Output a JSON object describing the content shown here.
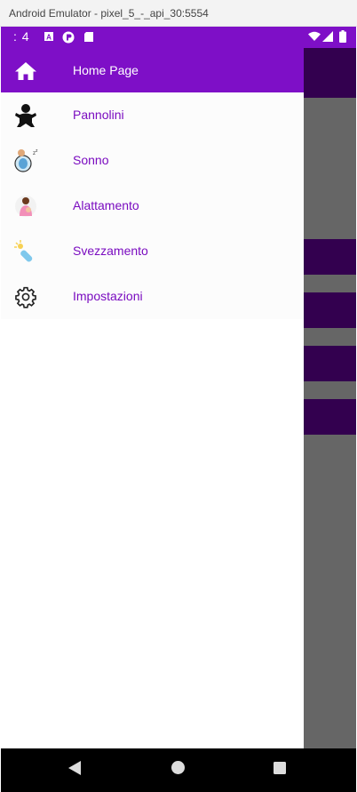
{
  "window": {
    "title": "Android Emulator - pixel_5_-_api_30:5554"
  },
  "status_bar": {
    "time": ": 4"
  },
  "drawer": {
    "items": [
      {
        "label": "Home Page",
        "icon": "home-icon",
        "active": true
      },
      {
        "label": "Pannolini",
        "icon": "baby-icon"
      },
      {
        "label": "Sonno",
        "icon": "sleeping-baby-icon"
      },
      {
        "label": "Alattamento",
        "icon": "breastfeeding-icon"
      },
      {
        "label": "Svezzamento",
        "icon": "baby-bottle-icon"
      },
      {
        "label": "Impostazioni",
        "icon": "gear-icon"
      }
    ]
  },
  "colors": {
    "primary": "#7e0fc7",
    "label": "#7a0bc0",
    "scrim": "#666666",
    "dark_block": "#33004f"
  }
}
